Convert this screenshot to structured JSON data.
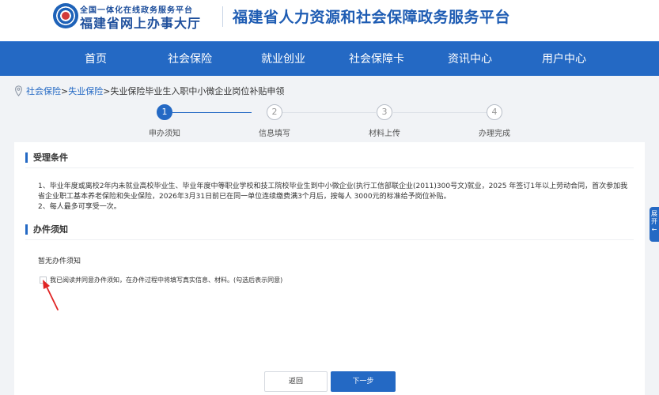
{
  "header": {
    "logo_top": "全国一体化在线政务服务平台",
    "logo_main": "福建省网上办事大厅",
    "platform_title": "福建省人力资源和社会保障政务服务平台"
  },
  "nav": {
    "items": [
      {
        "label": "首页"
      },
      {
        "label": "社会保险"
      },
      {
        "label": "就业创业"
      },
      {
        "label": "社会保障卡"
      },
      {
        "label": "资讯中心"
      },
      {
        "label": "用户中心"
      }
    ]
  },
  "breadcrumb": {
    "item1": "社会保险",
    "sep1": ">",
    "item2": "失业保险",
    "sep2": ">",
    "current": "失业保险毕业生入职中小微企业岗位补贴申领"
  },
  "steps": [
    {
      "number": "1",
      "label": "申办须知"
    },
    {
      "number": "2",
      "label": "信息填写"
    },
    {
      "number": "3",
      "label": "材料上传"
    },
    {
      "number": "4",
      "label": "办理完成"
    }
  ],
  "conditions": {
    "title": "受理条件",
    "line1": "1、毕业年度或离校2年内未就业高校毕业生、毕业年度中等职业学校和技工院校毕业生到中小微企业(执行工信部联企业(2011)300号文)就业，2025 年签订1年以上劳动合同，首次参加我省企业职工基本养老保险和失业保险，2026年3月31日前已在同一单位连续缴费满3个月后，按每人 3000元的标准给予岗位补贴。",
    "line2": "2、每人最多可享受一次。"
  },
  "notice": {
    "title": "办件须知",
    "empty_text": "暂无办件须知",
    "agree_text": "我已阅读并同意办件须知，在办件过程中将填写真实信息、材料。(勾选后表示同意)"
  },
  "buttons": {
    "back": "返回",
    "next": "下一步"
  },
  "side_tab": {
    "char1": "展",
    "char2": "开"
  },
  "colors": {
    "primary": "#2469c4",
    "title_blue": "#1e5cb3",
    "annotation_red": "#e02424"
  }
}
